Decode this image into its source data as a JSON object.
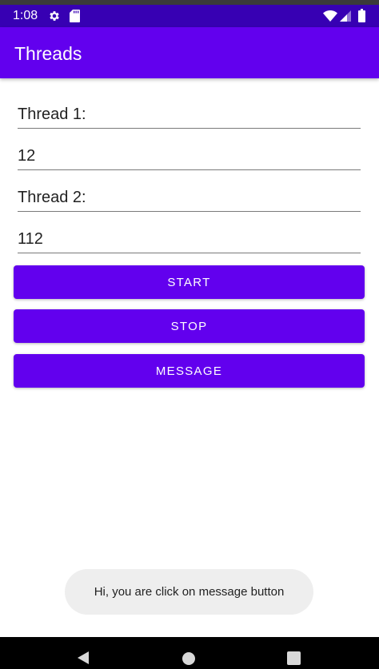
{
  "status_bar": {
    "time": "1:08",
    "icons": [
      "gear-icon",
      "sd-card-icon",
      "wifi-icon",
      "signal-icon",
      "battery-icon"
    ],
    "color": "#3700b3"
  },
  "app_bar": {
    "title": "Threads",
    "color": "#6200ee"
  },
  "fields": [
    {
      "name": "thread1-label-field",
      "value": "Thread 1:"
    },
    {
      "name": "thread1-value-field",
      "value": "12"
    },
    {
      "name": "thread2-label-field",
      "value": "Thread 2:"
    },
    {
      "name": "thread2-value-field",
      "value": "112"
    }
  ],
  "buttons": {
    "start": "START",
    "stop": "STOP",
    "message": "MESSAGE",
    "color": "#6200ee"
  },
  "toast": {
    "text": "Hi, you are click on message button"
  },
  "nav_bar": {
    "icons": [
      "back-icon",
      "home-icon",
      "recents-icon"
    ]
  }
}
